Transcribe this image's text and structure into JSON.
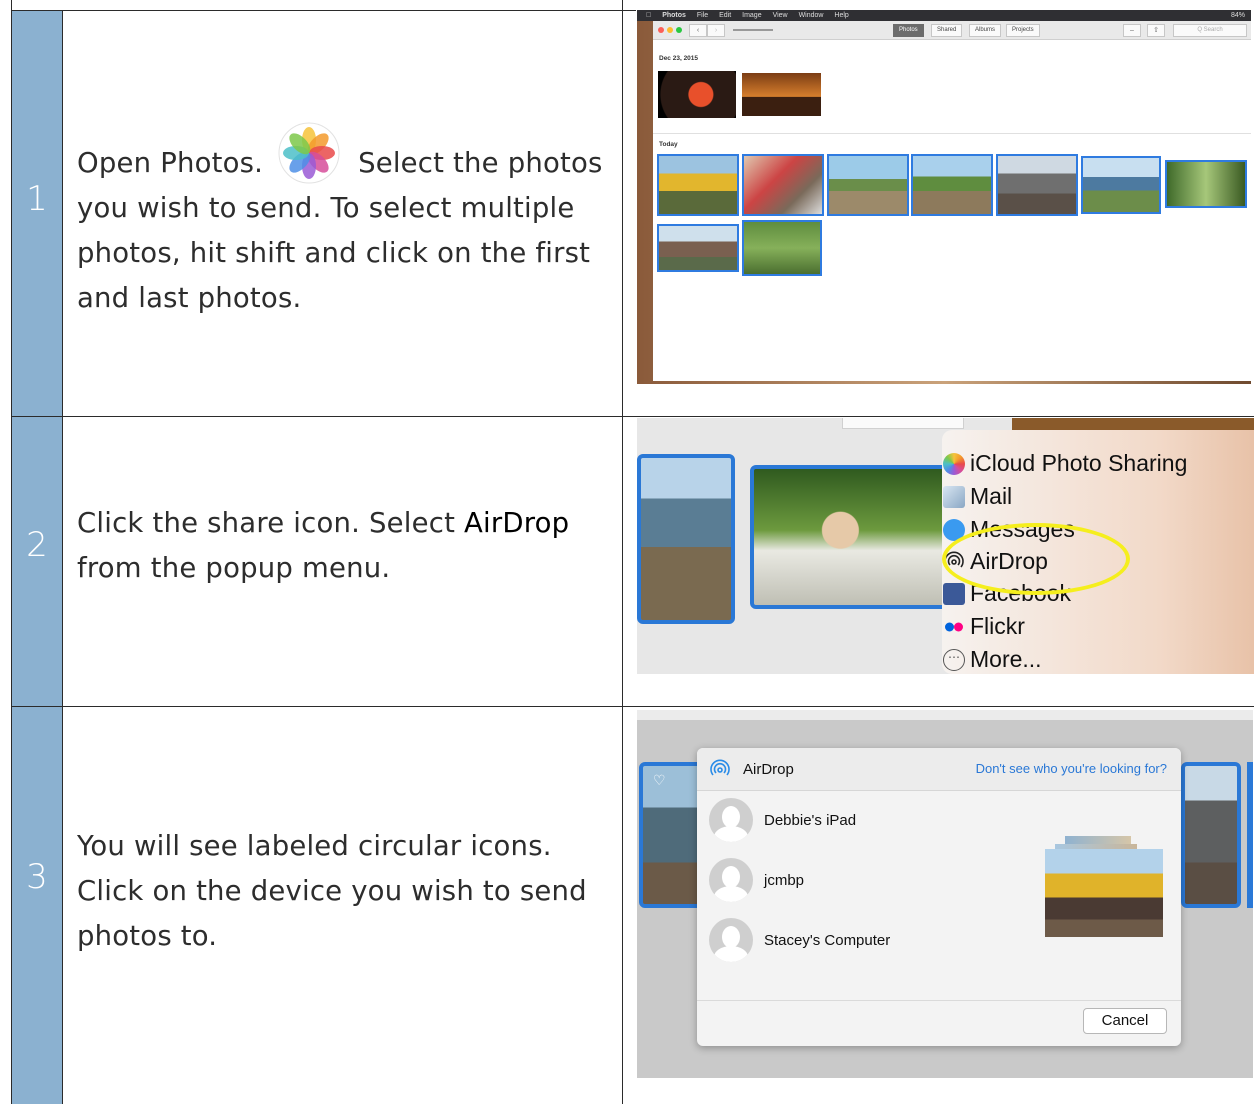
{
  "steps": [
    {
      "number": "1",
      "text_before_icon": "Open Photos.",
      "text_after_icon": "Select the photos you wish to send.  To select multiple photos, hit shift and click on the first and last photos."
    },
    {
      "number": "2",
      "text_before": "Click the share icon.  Select ",
      "text_bold": "AirDrop",
      "text_after": " from the popup menu."
    },
    {
      "number": "3",
      "text": "You will see labeled circular icons.  Click on the device you wish to send photos to."
    }
  ],
  "photos_app": {
    "menu": [
      "Photos",
      "File",
      "Edit",
      "Image",
      "View",
      "Window",
      "Help"
    ],
    "status_right": "84%",
    "tabs": [
      "Photos",
      "Shared",
      "Albums",
      "Projects"
    ],
    "active_tab": "Photos",
    "search_placeholder": "Q Search",
    "section_1": "Dec 23, 2015",
    "section_2": "Today"
  },
  "share_menu": {
    "items": [
      "iCloud Photo Sharing",
      "Mail",
      "Messages",
      "AirDrop",
      "Facebook",
      "Flickr",
      "More..."
    ],
    "highlighted": "AirDrop"
  },
  "airdrop_dialog": {
    "title": "AirDrop",
    "help_link": "Don't see who you're looking for?",
    "devices": [
      "Debbie's iPad",
      "jcmbp",
      "Stacey's Computer"
    ],
    "cancel_label": "Cancel"
  },
  "colors": {
    "step_cell": "#8bb1d0",
    "selection_blue": "#2f7be0",
    "highlight_circle": "#f5ee1d",
    "link_blue": "#2a78d6"
  }
}
